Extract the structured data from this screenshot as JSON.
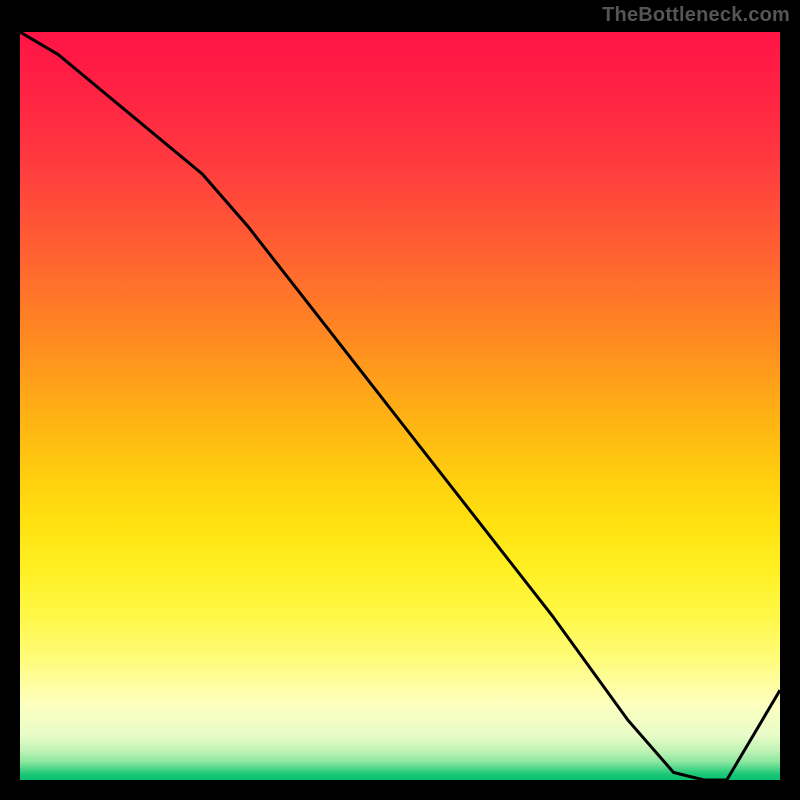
{
  "watermark": "TheBottleneck.com",
  "bottom_label": "",
  "chart_data": {
    "type": "line",
    "title": "",
    "xlabel": "",
    "ylabel": "",
    "xlim": [
      0,
      100
    ],
    "ylim": [
      0,
      100
    ],
    "series": [
      {
        "name": "curve",
        "x": [
          0,
          5,
          24,
          30,
          40,
          50,
          60,
          70,
          80,
          86,
          90,
          93,
          100
        ],
        "y": [
          100,
          97,
          81,
          74,
          61,
          48,
          35,
          22,
          8,
          1,
          0,
          0,
          12
        ]
      }
    ],
    "gradient_stops": [
      {
        "offset": 0.0,
        "color": "#ff1446"
      },
      {
        "offset": 0.06,
        "color": "#ff1e44"
      },
      {
        "offset": 0.12,
        "color": "#ff2c42"
      },
      {
        "offset": 0.18,
        "color": "#ff3c3e"
      },
      {
        "offset": 0.24,
        "color": "#ff4f38"
      },
      {
        "offset": 0.3,
        "color": "#ff6330"
      },
      {
        "offset": 0.36,
        "color": "#ff7828"
      },
      {
        "offset": 0.42,
        "color": "#ff8e20"
      },
      {
        "offset": 0.48,
        "color": "#ffa518"
      },
      {
        "offset": 0.54,
        "color": "#ffbb12"
      },
      {
        "offset": 0.6,
        "color": "#ffd00e"
      },
      {
        "offset": 0.66,
        "color": "#ffe210"
      },
      {
        "offset": 0.72,
        "color": "#fff024"
      },
      {
        "offset": 0.78,
        "color": "#fff846"
      },
      {
        "offset": 0.84,
        "color": "#fffc7c"
      },
      {
        "offset": 0.9,
        "color": "#fdffc0"
      },
      {
        "offset": 0.94,
        "color": "#e8fcc8"
      },
      {
        "offset": 0.96,
        "color": "#c2f4b6"
      },
      {
        "offset": 0.975,
        "color": "#8ee7a0"
      },
      {
        "offset": 0.985,
        "color": "#4cd688"
      },
      {
        "offset": 0.992,
        "color": "#1cc877"
      },
      {
        "offset": 1.0,
        "color": "#06c16e"
      }
    ]
  },
  "colors": {
    "line": "#000000",
    "frame": "#000000",
    "watermark": "#555555",
    "label": "#e11d48"
  }
}
